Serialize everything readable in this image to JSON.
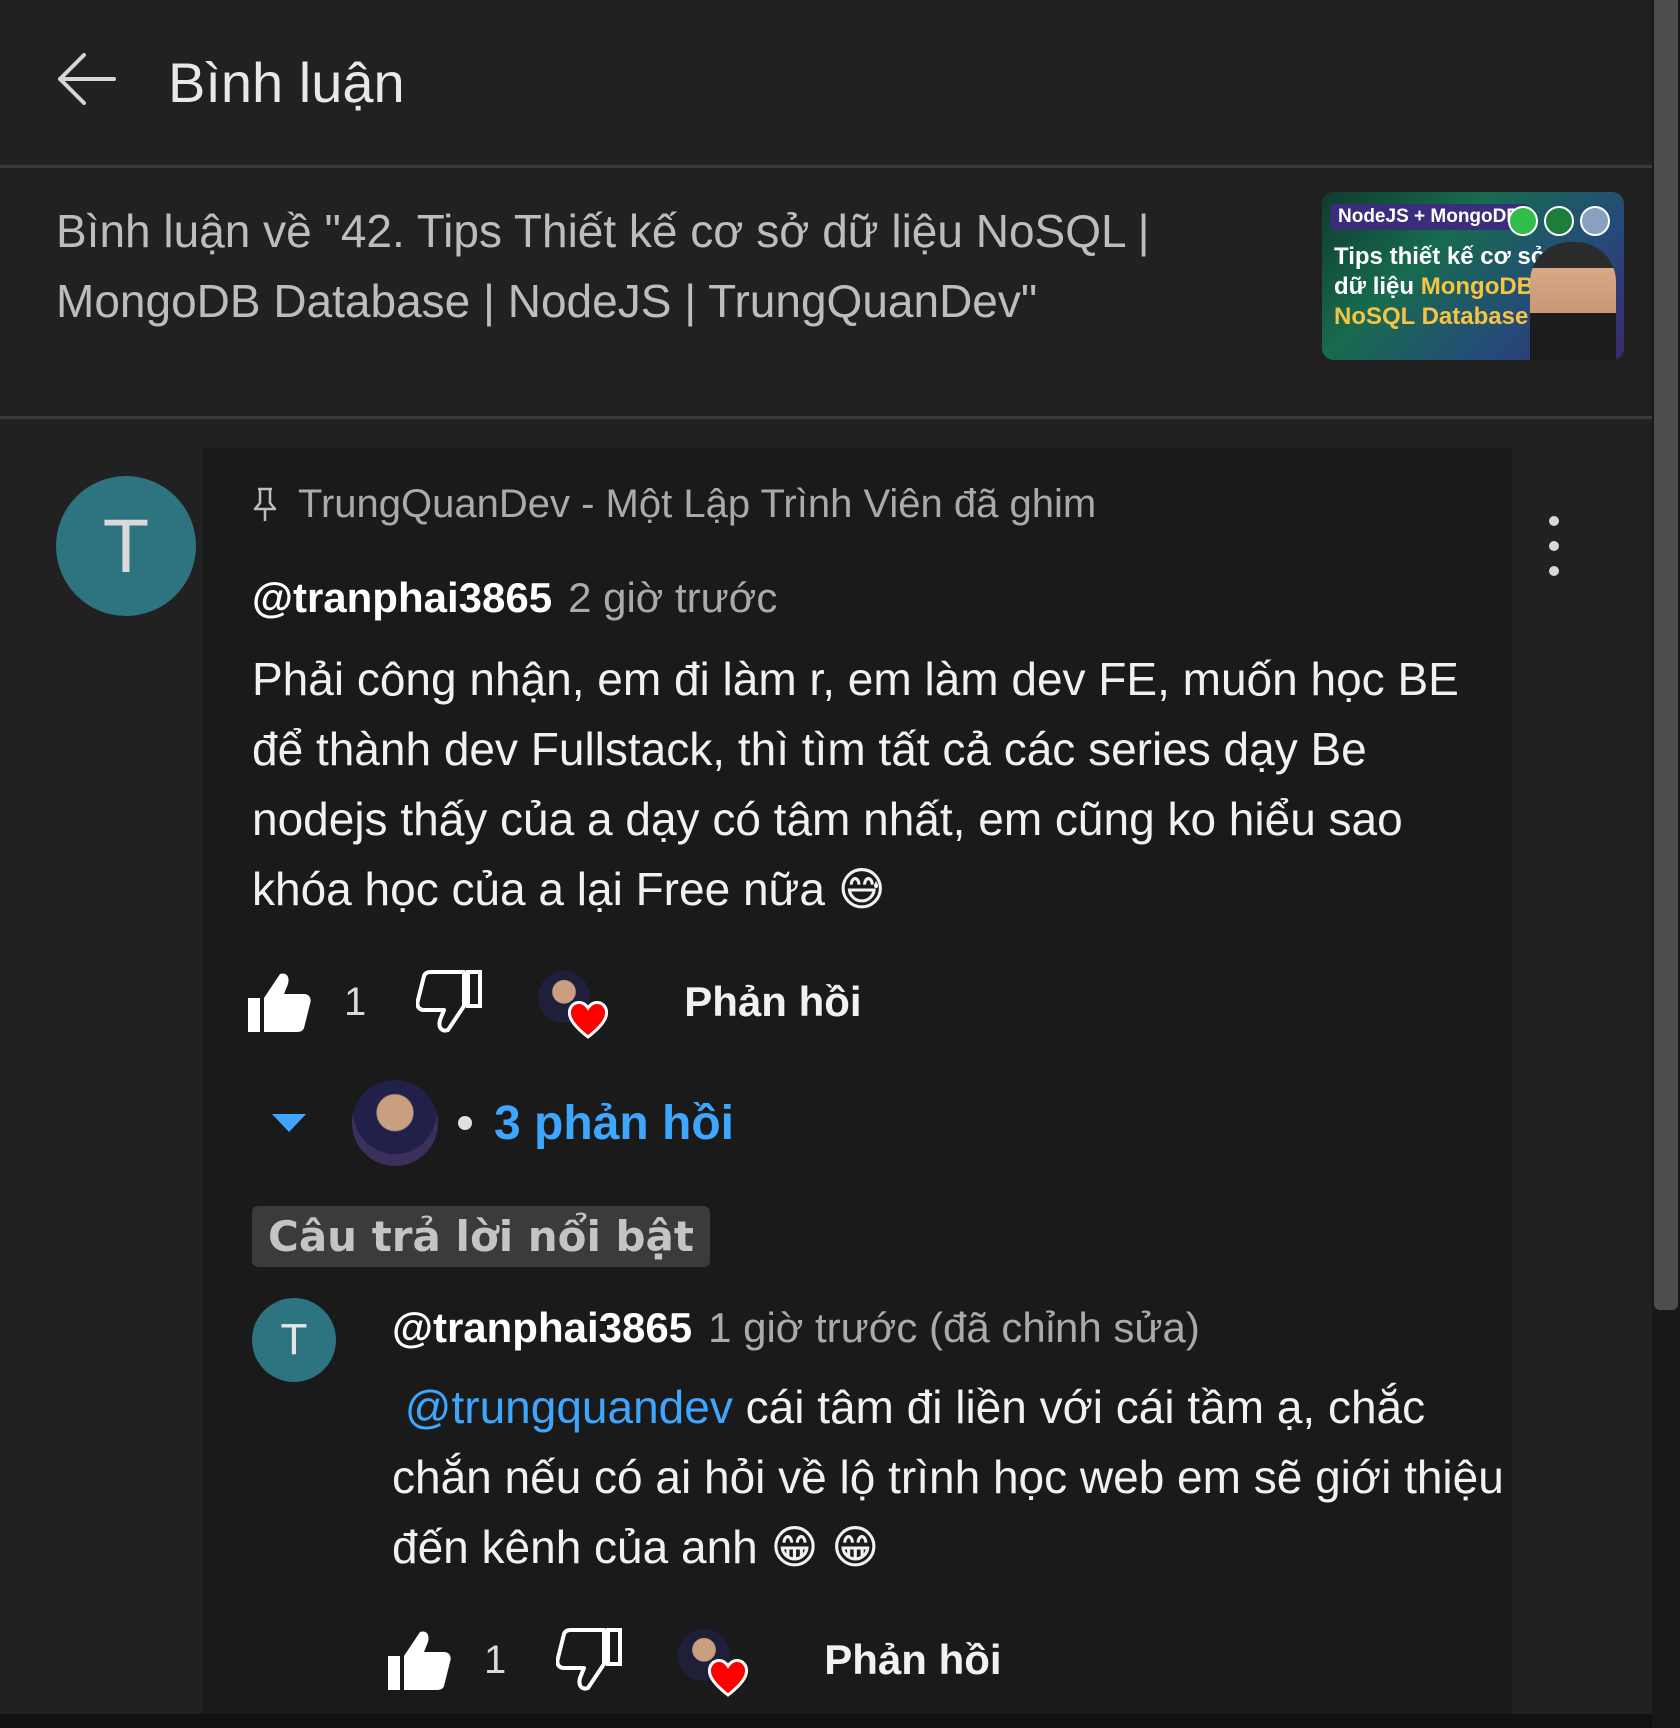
{
  "header": {
    "title": "Bình luận"
  },
  "video": {
    "title": "Bình luận về \"42. Tips Thiết kế cơ sở dữ liệu NoSQL | MongoDB Database | NodeJS | TrungQuanDev\"",
    "thumbnail": {
      "tag": "NodeJS + MongoDB",
      "line1": "Tips thiết kế cơ sở",
      "line2_prefix": "dữ liệu ",
      "line2_highlight": "MongoDB",
      "line3": "NoSQL Database"
    }
  },
  "comment": {
    "avatar_letter": "T",
    "pinned_text": "TrungQuanDev - Một Lập Trình Viên đã ghim",
    "author": "@tranphai3865",
    "time": "2 giờ trước",
    "text": "Phải công nhận, em đi làm r, em làm dev FE, muốn học BE để thành dev Fullstack, thì tìm tất cả các series dạy Be nodejs thấy của a dạy có tâm nhất, em cũng ko hiểu sao khóa học của a lại Free nữa 😅",
    "like_count": "1",
    "reply_label": "Phản hồi",
    "replies_count": "3 phản hồi"
  },
  "highlight_label": "Câu trả lời nổi bật",
  "reply": {
    "avatar_letter": "T",
    "author": "@tranphai3865",
    "time": "1 giờ trước (đã chỉnh sửa)",
    "mention": "@trungquandev",
    "text": " cái tâm đi liền với cái tầm ạ, chắc chắn nếu có ai hỏi về lộ trình học  web em sẽ giới thiệu đến kênh của anh 😁 😁",
    "like_count": "1",
    "reply_label": "Phản hồi"
  },
  "colors": {
    "background": "#212121",
    "link_blue": "#3ea6ff",
    "avatar_teal": "#2d7380",
    "heart_red": "#ff0000"
  },
  "icons": [
    "back-arrow-icon",
    "pin-icon",
    "more-vert-icon",
    "thumb-up-icon",
    "thumb-down-icon",
    "heart-icon",
    "caret-down-icon"
  ]
}
